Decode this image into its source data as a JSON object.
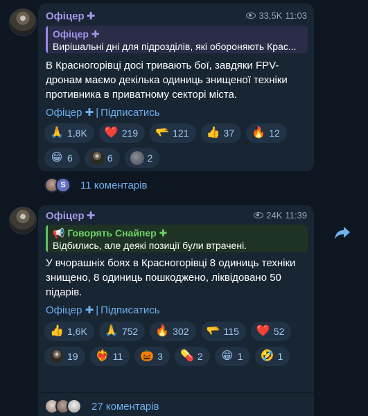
{
  "posts": [
    {
      "author": "Офіцер",
      "views": "33,5K",
      "time": "11:03",
      "quote": {
        "author": "Офіцер",
        "text": "Вирішальні дні для підрозділів, які обороняють Крас..."
      },
      "text": "В Красногорівці досі тривають бої, завдяки FPV-дронам маємо декілька одиниць знищеної техніки противника в приватному секторі міста.",
      "signature": {
        "name": "Офіцер",
        "link": "Підписатись"
      },
      "reactions": [
        {
          "emoji": "🙏",
          "count": "1,8K"
        },
        {
          "emoji": "❤️",
          "count": "219"
        },
        {
          "emoji": "🫳",
          "count": "121"
        },
        {
          "emoji": "👍",
          "count": "37"
        },
        {
          "emoji": "🔥",
          "count": "12"
        },
        {
          "emoji": "😁",
          "count": "6"
        },
        {
          "emoji": "avatar",
          "count": "6"
        },
        {
          "emoji": "ball",
          "count": "2"
        }
      ],
      "comments": "11 коментарів"
    },
    {
      "author": "Офіцер",
      "views": "24K",
      "time": "11:39",
      "quote": {
        "author": "📢 Говорять Снайпер ✚",
        "text": "Відбились, але деякі позиції були втрачені."
      },
      "text": "У вчорашніх боях в Красногорівці 8 одиниць техніки знищено, 8 одиниць пошкоджено, ліквідовано 50 підарів.",
      "signature": {
        "name": "Офіцер",
        "link": "Підписатись"
      },
      "reactions": [
        {
          "emoji": "👍",
          "count": "1,6K"
        },
        {
          "emoji": "🙏",
          "count": "752"
        },
        {
          "emoji": "🔥",
          "count": "302"
        },
        {
          "emoji": "🫳",
          "count": "115"
        },
        {
          "emoji": "❤️",
          "count": "52"
        },
        {
          "emoji": "avatar",
          "count": "19"
        },
        {
          "emoji": "❤️‍🔥",
          "count": "11"
        },
        {
          "emoji": "🎃",
          "count": "3"
        },
        {
          "emoji": "💊",
          "count": "2"
        },
        {
          "emoji": "😁",
          "count": "1"
        },
        {
          "emoji": "🤣",
          "count": "1"
        }
      ],
      "comments": "27 коментарів"
    }
  ],
  "colors": {
    "background": "#0e1621",
    "bubble": "#182533",
    "accent": "#6fb1ef",
    "author": "#a695e7",
    "reaction_bg": "#223245"
  }
}
